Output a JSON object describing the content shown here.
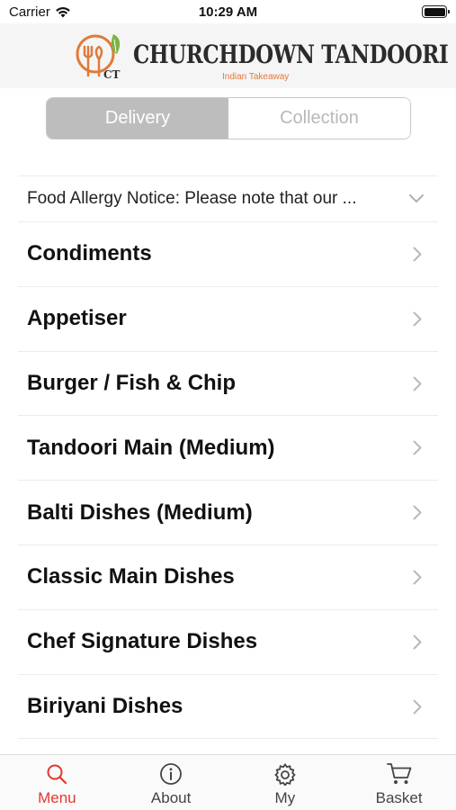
{
  "status_bar": {
    "carrier": "Carrier",
    "time": "10:29 AM"
  },
  "header": {
    "brand_name": "CHURCHDOWN TANDOORI",
    "brand_subtitle": "Indian Takeaway",
    "logo_initials": "CT",
    "accent_color": "#e07a3a",
    "leaf_color": "#7cb342"
  },
  "order_mode": {
    "options": [
      "Delivery",
      "Collection"
    ],
    "selected": "Delivery"
  },
  "notice": {
    "text": "Food Allergy Notice: Please note that our ...",
    "icon": "chevron-down-icon"
  },
  "categories": [
    {
      "label": "Condiments"
    },
    {
      "label": "Appetiser"
    },
    {
      "label": "Burger / Fish & Chip"
    },
    {
      "label": "Tandoori Main (Medium)"
    },
    {
      "label": "Balti Dishes (Medium)"
    },
    {
      "label": "Classic Main Dishes"
    },
    {
      "label": "Chef Signature Dishes"
    },
    {
      "label": "Biriyani Dishes"
    }
  ],
  "tabbar": {
    "active_color": "#e2382f",
    "tabs": [
      {
        "label": "Menu",
        "icon": "search-icon",
        "active": true
      },
      {
        "label": "About",
        "icon": "info-icon",
        "active": false
      },
      {
        "label": "My",
        "icon": "gear-icon",
        "active": false
      },
      {
        "label": "Basket",
        "icon": "cart-icon",
        "active": false
      }
    ]
  }
}
